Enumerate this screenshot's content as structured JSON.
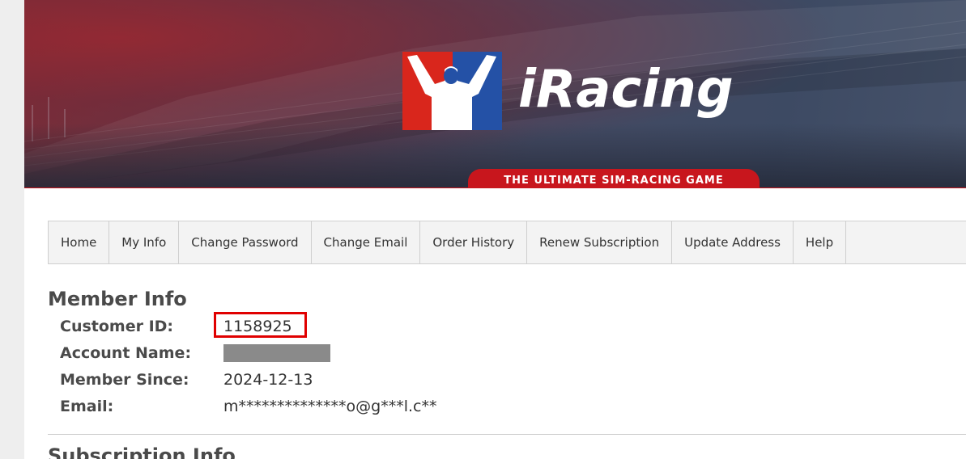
{
  "banner": {
    "brand": "iRacing",
    "tagline": "THE ULTIMATE SIM-RACING GAME",
    "colors": {
      "red": "#c8161d",
      "blue": "#1f4ea1",
      "white": "#ffffff"
    }
  },
  "nav": {
    "items": [
      {
        "label": "Home"
      },
      {
        "label": "My Info"
      },
      {
        "label": "Change Password"
      },
      {
        "label": "Change Email"
      },
      {
        "label": "Order History"
      },
      {
        "label": "Renew Subscription"
      },
      {
        "label": "Update Address"
      },
      {
        "label": "Help"
      }
    ]
  },
  "member": {
    "heading": "Member Info",
    "customer_id_label": "Customer ID:",
    "customer_id": "1158925",
    "account_name_label": "Account Name:",
    "member_since_label": "Member Since:",
    "member_since": "2024-12-13",
    "email_label": "Email:",
    "email": "m**************o@g***l.c**",
    "highlight_color": "#e00000"
  },
  "subscription": {
    "heading": "Subscription Info"
  }
}
